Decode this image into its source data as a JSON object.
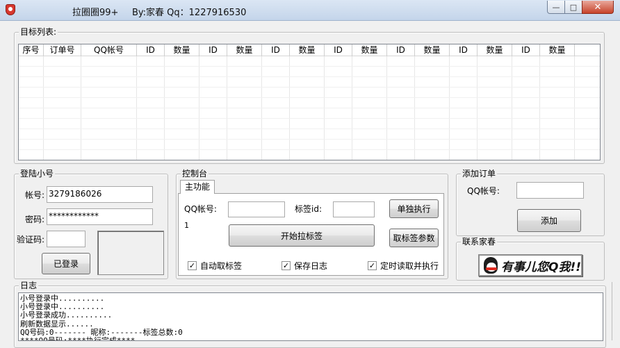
{
  "window": {
    "title_app": "拉圈圈99+",
    "title_author": "By:家春 Qq：1227916530",
    "minimize": "—",
    "maximize": "□",
    "close": "✕"
  },
  "targets": {
    "legend": "目标列表:",
    "columns": [
      "序号",
      "订单号",
      "QQ帐号",
      "ID",
      "数量",
      "ID",
      "数量",
      "ID",
      "数量",
      "ID",
      "数量",
      "ID",
      "数量",
      "ID",
      "数量",
      "ID",
      "数量"
    ]
  },
  "login": {
    "legend": "登陆小号",
    "account_label": "帐号:",
    "account_value": "3279186026",
    "password_label": "密码:",
    "password_value": "************",
    "captcha_label": "验证码:",
    "captcha_value": "",
    "login_button": "已登录"
  },
  "control": {
    "legend": "控制台",
    "tab_main": "主功能",
    "qq_label": "QQ帐号:",
    "qq_value": "",
    "tag_label": "标签id:",
    "tag_value": "",
    "single_button": "单独执行",
    "counter": "1",
    "start_button": "开始拉标签",
    "fetch_params_button": "取标签参数",
    "cb_auto_label": "自动取标签",
    "cb_save_log": "保存日志",
    "cb_timed": "定时读取并执行",
    "check_mark": "✓"
  },
  "add_order": {
    "legend": "添加订单",
    "qq_label": "QQ帐号:",
    "qq_value": "",
    "add_button": "添加"
  },
  "contact": {
    "legend": "联系家春",
    "qq_button_text": "有事儿您Q我!!"
  },
  "log": {
    "legend": "日志",
    "lines": [
      "小号登录中..........",
      "小号登录中..........",
      "小号登录成功..........",
      "刷新数据显示......",
      "QQ号码:0------- 昵称:-------标签总数:0",
      "****QQ号码:****执行完成****"
    ]
  }
}
